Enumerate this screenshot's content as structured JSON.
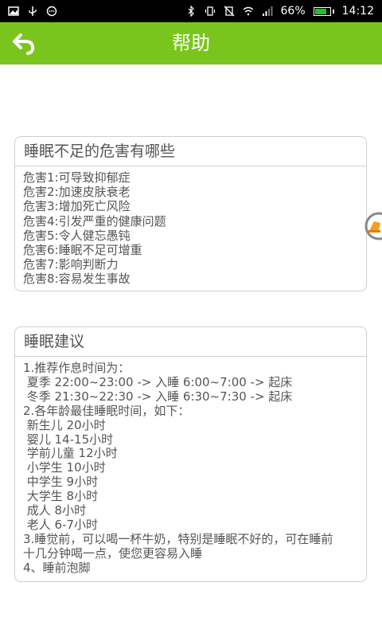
{
  "status_bar": {
    "battery": "66%",
    "time": "14:12"
  },
  "header": {
    "title": "帮助"
  },
  "cards": [
    {
      "title": "睡眠不足的危害有哪些",
      "lines": [
        "危害1:可导致抑郁症",
        "危害2:加速皮肤衰老",
        "危害3:增加死亡风险",
        "危害4:引发严重的健康问题",
        "危害5:令人健忘愚钝",
        "危害6:睡眠不足可增重",
        "危害7:影响判断力",
        "危害8:容易发生事故"
      ]
    },
    {
      "title": "睡眠建议",
      "lines": [
        "1.推荐作息时间为：",
        " 夏季 22:00~23:00 -> 入睡 6:00~7:00 -> 起床",
        " 冬季 21:30~22:30 -> 入睡 6:30~7:30 -> 起床",
        "2.各年龄最佳睡眠时间，如下：",
        " 新生儿 20小时",
        " 婴儿 14-15小时",
        " 学前儿童 12小时",
        " 小学生 10小时",
        " 中学生 9小时",
        " 大学生 8小时",
        " 成人 8小时",
        " 老人 6-7小时",
        "3.睡觉前，可以喝一杯牛奶，特别是睡眠不好的，可在睡前",
        "十几分钟喝一点，使您更容易入睡",
        "4、睡前泡脚"
      ]
    }
  ],
  "colors": {
    "accent": "#7ac51d",
    "card_border": "#cfcfcf",
    "text": "#555555"
  },
  "icons": {
    "back": "back-arrow-icon",
    "float": "assistive-float-icon"
  }
}
